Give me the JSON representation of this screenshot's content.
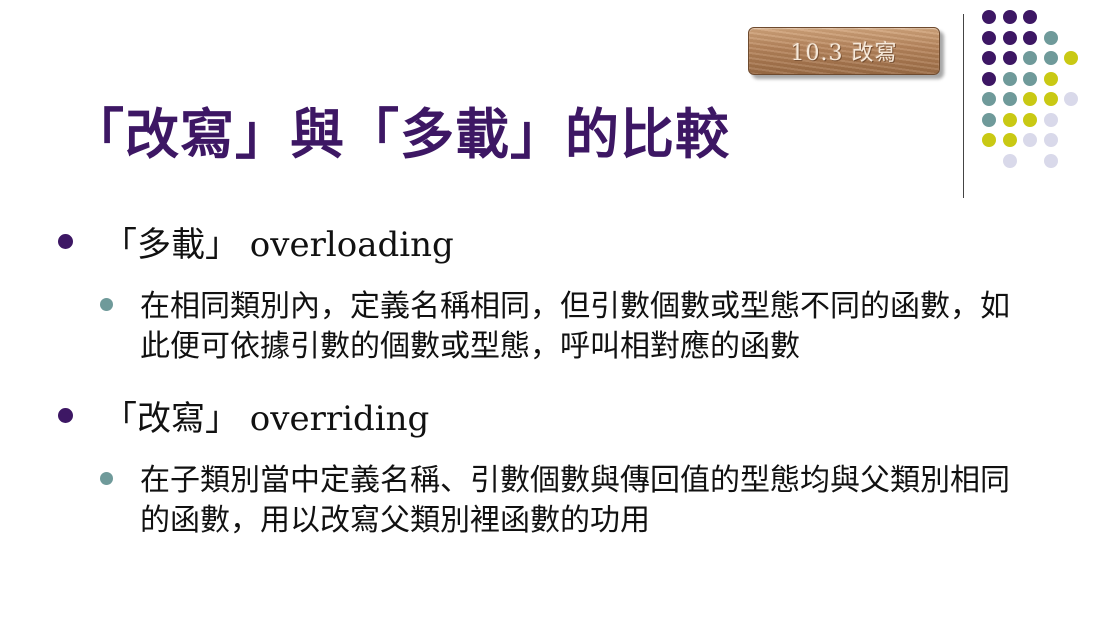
{
  "slide": {
    "section_tag": "10.3 改寫",
    "title": "「改寫」與「多載」的比較",
    "bullets": [
      {
        "label": "「多載」 overloading",
        "sub": "在相同類別內，定義名稱相同，但引數個數或型態不同的函數，如此便可依據引數的個數或型態，呼叫相對應的函數"
      },
      {
        "label": "「改寫」 overriding",
        "sub": "在子類別當中定義名稱、引數個數與傳回值的型態均與父類別相同的函數，用以改寫父類別裡函數的功用"
      }
    ]
  },
  "decoration": {
    "colors": {
      "purple": "#3d1764",
      "teal": "#6f9a9a",
      "lime": "#c9c914",
      "lavender": "#d9d9ea"
    },
    "dot_rows": [
      [
        "purple",
        "purple",
        "purple",
        "",
        ""
      ],
      [
        "purple",
        "purple",
        "purple",
        "teal",
        ""
      ],
      [
        "purple",
        "purple",
        "teal",
        "teal",
        "lime"
      ],
      [
        "purple",
        "teal",
        "teal",
        "lime",
        ""
      ],
      [
        "teal",
        "teal",
        "lime",
        "lime",
        "lavender"
      ],
      [
        "teal",
        "lime",
        "lime",
        "lavender",
        ""
      ],
      [
        "lime",
        "lime",
        "lavender",
        "lavender",
        ""
      ],
      [
        "",
        "lavender",
        "",
        "lavender",
        ""
      ]
    ]
  }
}
